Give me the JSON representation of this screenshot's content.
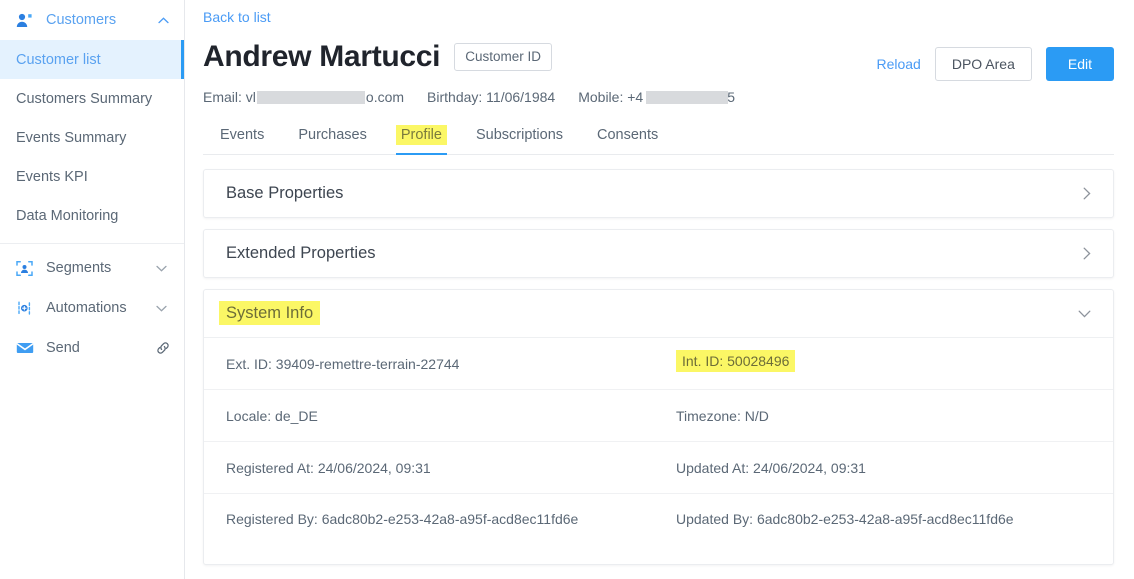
{
  "sidebar": {
    "group": {
      "label": "Customers",
      "icon": "users-icon",
      "chevron": "chevron-up-icon"
    },
    "sub_items": [
      {
        "label": "Customer list",
        "active": true
      },
      {
        "label": "Customers Summary",
        "active": false
      },
      {
        "label": "Events Summary",
        "active": false
      },
      {
        "label": "Events KPI",
        "active": false
      },
      {
        "label": "Data Monitoring",
        "active": false
      }
    ],
    "rows": [
      {
        "label": "Segments",
        "icon": "segments-icon",
        "trail": "chevron-down-icon"
      },
      {
        "label": "Automations",
        "icon": "automations-icon",
        "trail": "chevron-down-icon"
      },
      {
        "label": "Send",
        "icon": "envelope-icon",
        "trail": "external-link-icon"
      }
    ]
  },
  "header": {
    "back_link": "Back to list",
    "title": "Andrew Martucci",
    "id_badge": "Customer ID",
    "reload_label": "Reload",
    "dpo_label": "DPO Area",
    "edit_label": "Edit"
  },
  "meta": {
    "email_prefix": "Email: vl",
    "email_suffix": "o.com",
    "birthday": "Birthday: 11/06/1984",
    "mobile_prefix": "Mobile: +4",
    "mobile_suffix": "5"
  },
  "tabs": [
    {
      "label": "Events",
      "active": false
    },
    {
      "label": "Purchases",
      "active": false
    },
    {
      "label": "Profile",
      "active": true
    },
    {
      "label": "Subscriptions",
      "active": false
    },
    {
      "label": "Consents",
      "active": false
    }
  ],
  "panels": [
    {
      "title": "Base Properties",
      "expanded": false,
      "chevron": "chevron-right-icon"
    },
    {
      "title": "Extended Properties",
      "expanded": false,
      "chevron": "chevron-right-icon"
    },
    {
      "title": "System Info",
      "expanded": true,
      "chevron": "chevron-down-icon"
    }
  ],
  "system_info": {
    "ext_id": "Ext. ID: 39409-remettre-terrain-22744",
    "int_id": "Int. ID: 50028496",
    "locale": "Locale: de_DE",
    "timezone": "Timezone: N/D",
    "registered_at": "Registered At: 24/06/2024, 09:31",
    "updated_at": "Updated At: 24/06/2024, 09:31",
    "registered_by": "Registered By: 6adc80b2-e253-42a8-a95f-acd8ec11fd6e",
    "updated_by": "Updated By: 6adc80b2-e253-42a8-a95f-acd8ec11fd6e"
  },
  "colors": {
    "accent_blue": "#2b9bf4",
    "link_blue": "#4a9bf5",
    "active_nav_bg": "#e4f2fe",
    "highlight_yellow": "#fbf765",
    "text_dark": "#20242c",
    "text_muted": "#5b6876"
  }
}
